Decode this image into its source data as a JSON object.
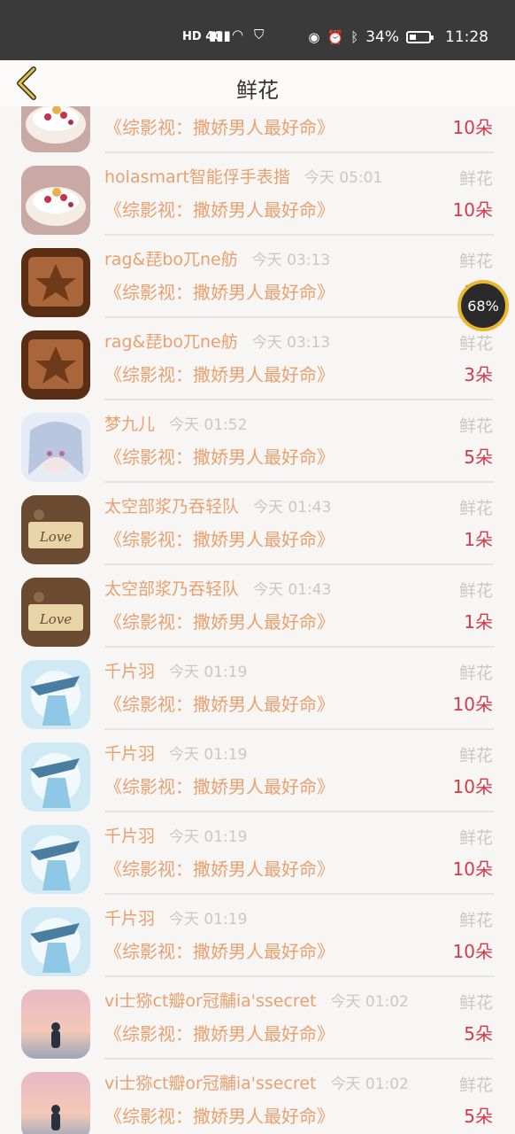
{
  "status": {
    "network": "HD 4G",
    "battery": "34%",
    "battery_level": 0.34,
    "time": "11:28",
    "icons": [
      "signal-icon",
      "wifi-icon",
      "shield-icon",
      "eye-icon",
      "bluetooth-icon",
      "alarm-icon"
    ]
  },
  "nav": {
    "title": "鲜花",
    "back_icon": "chevron-left-icon"
  },
  "floatball": {
    "percent": "68%"
  },
  "rows": [
    {
      "name": "",
      "time": "",
      "type": "",
      "book": "《综影视：撒娇男人最好命》",
      "count": "10朵",
      "avatar": "dessert"
    },
    {
      "name": "holasmart智能俘手表揩",
      "time": "今天 05:01",
      "type": "鲜花",
      "book": "《综影视：撒娇男人最好命》",
      "count": "10朵",
      "avatar": "dessert"
    },
    {
      "name": "rag&琵bo兀ne舫",
      "time": "今天 03:13",
      "type": "鲜花",
      "book": "《综影视：撒娇男人最好命》",
      "count": "3朵",
      "avatar": "leather"
    },
    {
      "name": "rag&琵bo兀ne舫",
      "time": "今天 03:13",
      "type": "鲜花",
      "book": "《综影视：撒娇男人最好命》",
      "count": "3朵",
      "avatar": "leather"
    },
    {
      "name": "梦九儿",
      "time": "今天 01:52",
      "type": "鲜花",
      "book": "《综影视：撒娇男人最好命》",
      "count": "5朵",
      "avatar": "anime"
    },
    {
      "name": "太空部浆乃吞轻队",
      "time": "今天 01:43",
      "type": "鲜花",
      "book": "《综影视：撒娇男人最好命》",
      "count": "1朵",
      "avatar": "love"
    },
    {
      "name": "太空部浆乃吞轻队",
      "time": "今天 01:43",
      "type": "鲜花",
      "book": "《综影视：撒娇男人最好命》",
      "count": "1朵",
      "avatar": "love"
    },
    {
      "name": "千片羽",
      "time": "今天 01:19",
      "type": "鲜花",
      "book": "《综影视：撒娇男人最好命》",
      "count": "10朵",
      "avatar": "ice"
    },
    {
      "name": "千片羽",
      "time": "今天 01:19",
      "type": "鲜花",
      "book": "《综影视：撒娇男人最好命》",
      "count": "10朵",
      "avatar": "ice"
    },
    {
      "name": "千片羽",
      "time": "今天 01:19",
      "type": "鲜花",
      "book": "《综影视：撒娇男人最好命》",
      "count": "10朵",
      "avatar": "ice"
    },
    {
      "name": "千片羽",
      "time": "今天 01:19",
      "type": "鲜花",
      "book": "《综影视：撒娇男人最好命》",
      "count": "10朵",
      "avatar": "ice"
    },
    {
      "name": "vi士猕ct瓣or冠黼ia'ssecret",
      "time": "今天 01:02",
      "type": "鲜花",
      "book": "《综影视：撒娇男人最好命》",
      "count": "5朵",
      "avatar": "sunset"
    },
    {
      "name": "vi士猕ct瓣or冠黼ia'ssecret",
      "time": "今天 01:02",
      "type": "鲜花",
      "book": "《综影视：撒娇男人最好命》",
      "count": "5朵",
      "avatar": "sunset"
    }
  ]
}
